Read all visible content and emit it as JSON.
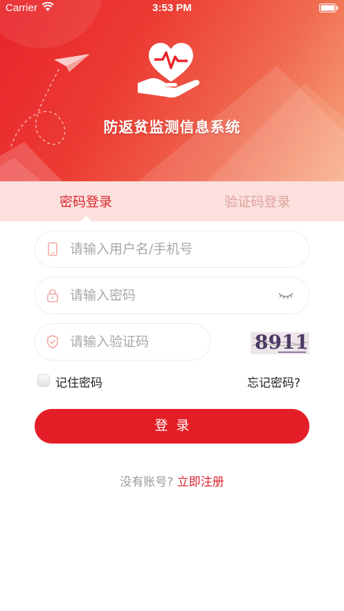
{
  "status_bar": {
    "carrier": "Carrier",
    "time": "3:53 PM"
  },
  "header": {
    "title": "防返贫监测信息系统",
    "logo_icon": "heart-in-hand-icon"
  },
  "tabs": [
    {
      "label": "密码登录",
      "active": true
    },
    {
      "label": "验证码登录",
      "active": false
    }
  ],
  "form": {
    "username_placeholder": "请输入用户名/手机号",
    "username_value": "",
    "password_placeholder": "请输入密码",
    "password_value": "",
    "code_placeholder": "请输入验证码",
    "code_value": "",
    "captcha_text": "8911",
    "remember_label": "记住密码",
    "remember_checked": false,
    "forgot_label": "忘记密码?",
    "login_label": "登录"
  },
  "register": {
    "question": "没有账号?",
    "link": "立即注册"
  },
  "colors": {
    "primary": "#e41e27",
    "tab_bg": "#fbe0dd",
    "inactive_tab": "#dfa39d",
    "placeholder": "#a8a8a8"
  }
}
